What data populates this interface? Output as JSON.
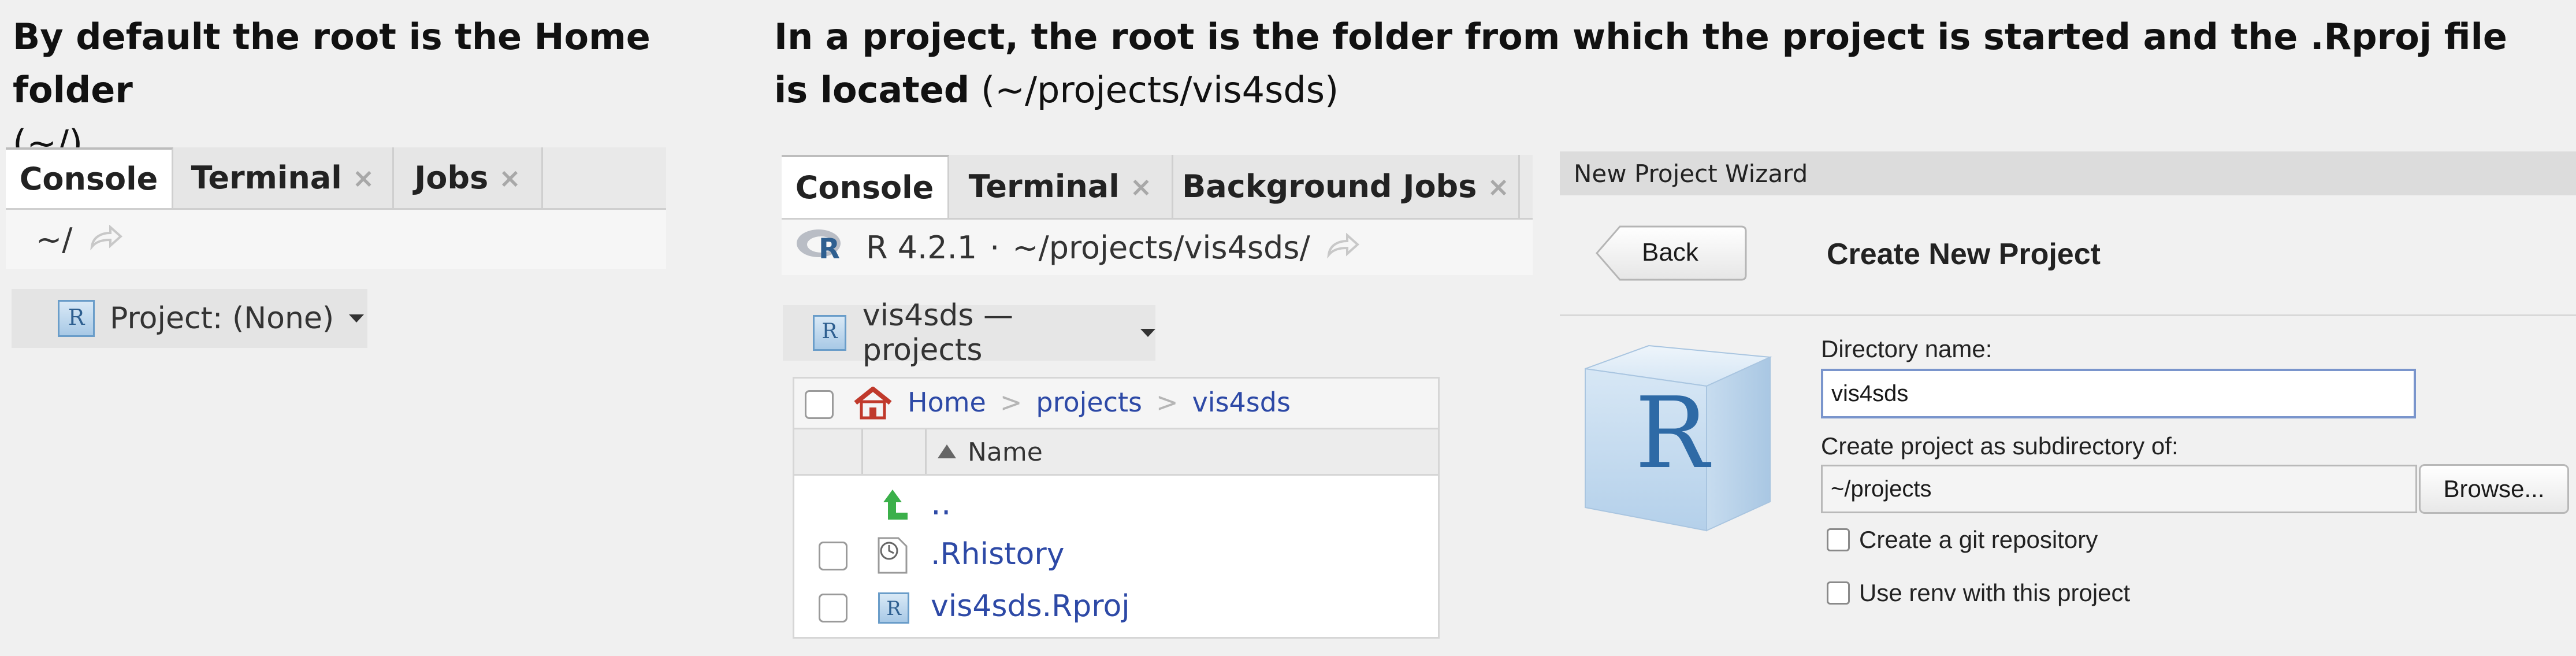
{
  "captions": {
    "left_bold": "By default the root is the Home folder",
    "left_normal": "(~/)",
    "right_bold_line1": "In a project, the root is the folder from which the project is started and the .Rproj file",
    "right_bold_line2": "is located",
    "right_normal": "(~/projects/vis4sds)"
  },
  "left_panel": {
    "tabs": [
      "Console",
      "Terminal",
      "Jobs"
    ],
    "close_glyph": "×",
    "path": "~/",
    "project_label": "Project: (None)"
  },
  "middle_panel": {
    "tabs": [
      "Console",
      "Terminal",
      "Background Jobs"
    ],
    "close_glyph": "×",
    "r_version": "R 4.2.1",
    "separator": "·",
    "path": "~/projects/vis4sds/",
    "project_label": "vis4sds — projects",
    "breadcrumb": [
      "Home",
      "projects",
      "vis4sds"
    ],
    "breadcrumb_sep": ">",
    "column_name": "Name",
    "files": [
      {
        "name": "..",
        "icon": "up-arrow-icon"
      },
      {
        "name": ".Rhistory",
        "icon": "history-file-icon"
      },
      {
        "name": "vis4sds.Rproj",
        "icon": "rproj-icon"
      }
    ]
  },
  "wizard": {
    "window_title": "New Project Wizard",
    "back_label": "Back",
    "heading": "Create New Project",
    "logo_letter": "R",
    "dir_label": "Directory name:",
    "dir_value": "vis4sds",
    "subdir_label": "Create project as subdirectory of:",
    "subdir_value": "~/projects",
    "browse_label": "Browse...",
    "git_label": "Create a git repository",
    "renv_label": "Use renv with this project"
  },
  "colors": {
    "link": "#2d49a6",
    "home_icon": "#c0392b",
    "up_arrow": "#3bb04a",
    "r_logo": "#2e5f90"
  }
}
